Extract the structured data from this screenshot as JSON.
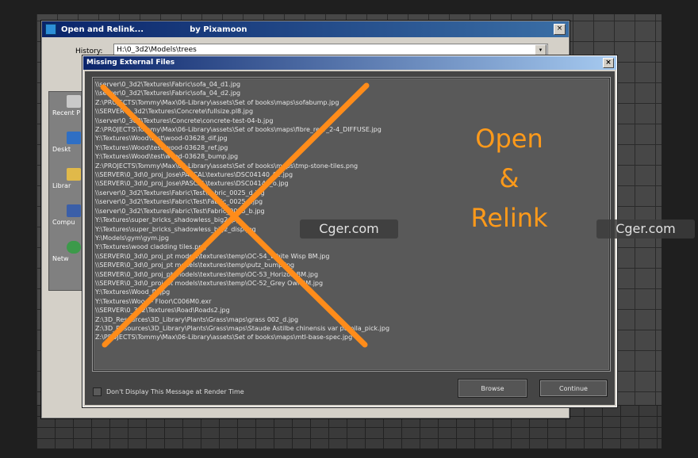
{
  "back_window": {
    "title": "Open and Relink...",
    "byline": "by Pixamoon",
    "close": "×",
    "history_label": "History:",
    "history_value": "H:\\0_3d2\\Models\\trees",
    "dropdown_glyph": "▾",
    "places": [
      "Recent P",
      "Deskt",
      "Librar",
      "Compu",
      "Netw"
    ]
  },
  "dialog": {
    "title": "Missing External Files",
    "close": "×",
    "files": [
      "\\\\server\\0_3d2\\Textures\\Fabric\\sofa_04_d1.jpg",
      "\\\\server\\0_3d2\\Textures\\Fabric\\sofa_04_d2.jpg",
      "Z:\\PROJECTS\\Tommy\\Max\\06-Library\\assets\\Set of  books\\maps\\sofabump.jpg",
      "\\\\SERVER\\0_3d2\\Textures\\Concrete\\fullsize.pl8.jpg",
      "\\\\server\\0_3d2\\Textures\\Concrete\\concrete-test-04-b.jpg",
      "Z:\\PROJECTS\\Tommy\\Max\\06-Library\\assets\\Set of  books\\maps\\fibre_rear_2-4_DIFFUSE.jpg",
      "Y:\\Textures\\Wood\\test\\wood-03628_dif.jpg",
      "Y:\\Textures\\Wood\\test\\wood-03628_ref.jpg",
      "Y:\\Textures\\Wood\\test\\wood-03628_bump.jpg",
      "Z:\\PROJECTS\\Tommy\\Max\\06-Library\\assets\\Set of  books\\maps\\tmp-stone-tiles.png",
      "\\\\SERVER\\0_3d\\0_proj_Jose\\PASCAL\\textures\\DSC04140_02.jpg",
      "\\\\SERVER\\0_3d\\0_proj_Jose\\PASCAL\\textures\\DSC04140_o.jpg",
      "\\\\server\\0_3d2\\Textures\\Fabric\\Test\\Fabric_0025_d.jpg",
      "\\\\server\\0_3d2\\Textures\\Fabric\\Test\\Fabric_0025_r.jpg",
      "\\\\server\\0_3d2\\Textures\\Fabric\\Test\\Fabric_0025_b.jpg",
      "Y:\\Textures\\super_bricks_shadowless_big2.jpg",
      "Y:\\Textures\\super_bricks_shadowless_big2_disp.jpg",
      "Y:\\Models\\gym\\gym.jpg",
      "Y:\\Textures\\wood cladding tiles.png",
      "\\\\SERVER\\0_3d\\0_proj_pt models\\textures\\temp\\OC-54_White Wisp BM.jpg",
      "\\\\SERVER\\0_3d\\0_proj_pt models\\textures\\temp\\putz_bump.jpg",
      "\\\\SERVER\\0_3d\\0_proj_pt models\\textures\\temp\\OC-53_Horizon BM.jpg",
      "\\\\SERVER\\0_3d\\0_proj_pt models\\textures\\temp\\OC-52_Grey Owl BM.jpg",
      "Y:\\Textures\\Wood_flr.jpg",
      "Y:\\Textures\\Wood - Floor\\C006M0.exr",
      "\\\\SERVER\\0_3d2\\Textures\\Road\\Roads2.jpg",
      "Z:\\3D_Resources\\3D_Library\\Plants\\Grass\\maps\\grass 002_d.jpg",
      "Z:\\3D_Resources\\3D_Library\\Plants\\Grass\\maps\\Staude Astilbe chinensis var pumila_pick.jpg",
      "Z:\\PROJECTS\\Tommy\\Max\\06-Library\\assets\\Set of  books\\maps\\mtl-base-spec.jpg"
    ],
    "checkbox_label": "Don't Display This Message at Render Time",
    "browse_label": "Browse",
    "continue_label": "Continue"
  },
  "promo": {
    "line1": "Open",
    "line2": "&",
    "line3": "Relink",
    "color": "#ff9a1a",
    "x_color": "#ff8c1a"
  },
  "watermarks": [
    "Cger.com",
    "Cger.com"
  ]
}
